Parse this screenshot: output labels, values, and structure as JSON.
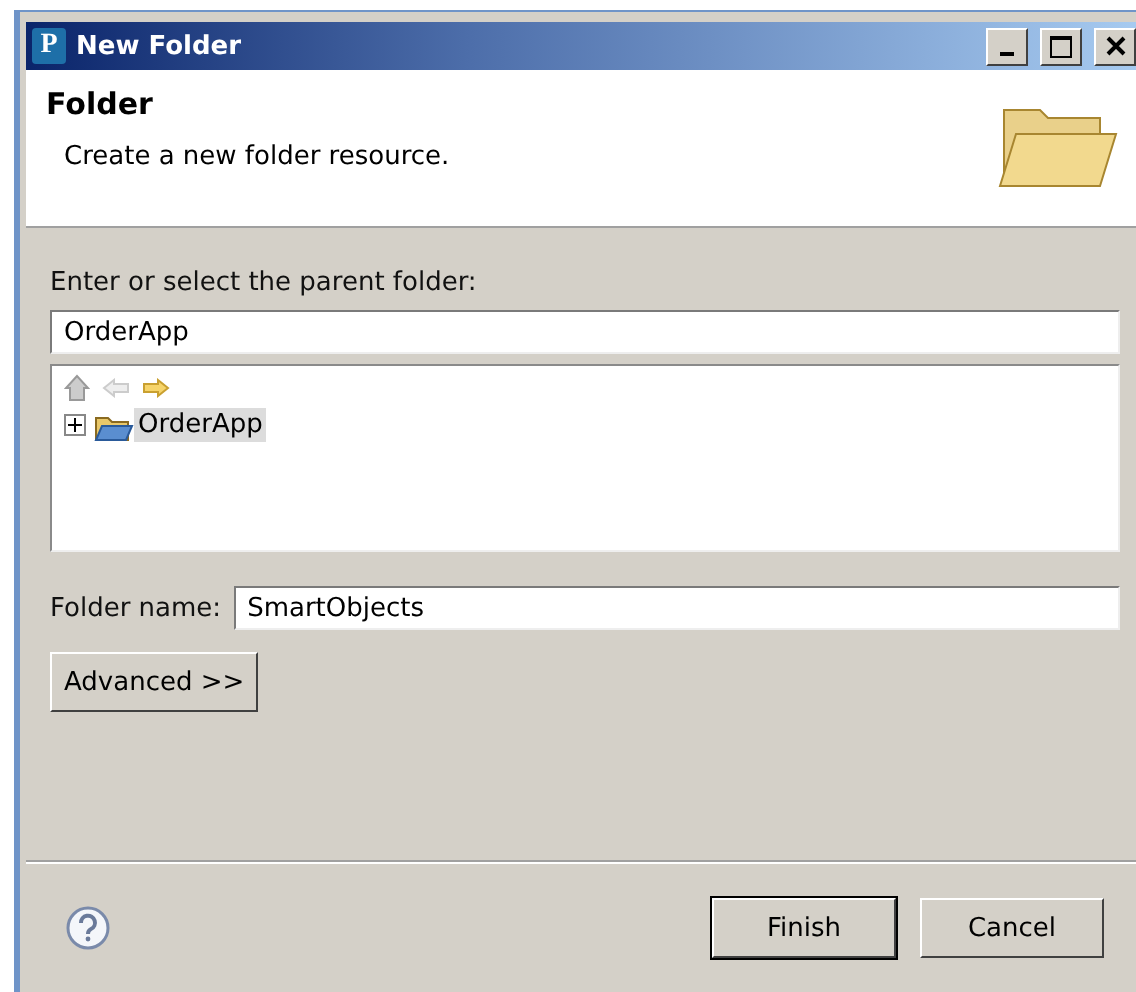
{
  "window": {
    "title": "New Folder",
    "app_letter": "P"
  },
  "header": {
    "title": "Folder",
    "description": "Create a new folder resource."
  },
  "parent": {
    "label": "Enter or select the parent folder:",
    "value": "OrderApp"
  },
  "tree": {
    "items": [
      {
        "label": "OrderApp",
        "selected": true,
        "expanded": false
      }
    ]
  },
  "folder_name": {
    "label": "Folder name:",
    "value": "SmartObjects"
  },
  "advanced_button": "Advanced >>",
  "buttons": [
    {
      "label": "Finish",
      "default": true
    },
    {
      "label": "Cancel",
      "default": false
    }
  ]
}
